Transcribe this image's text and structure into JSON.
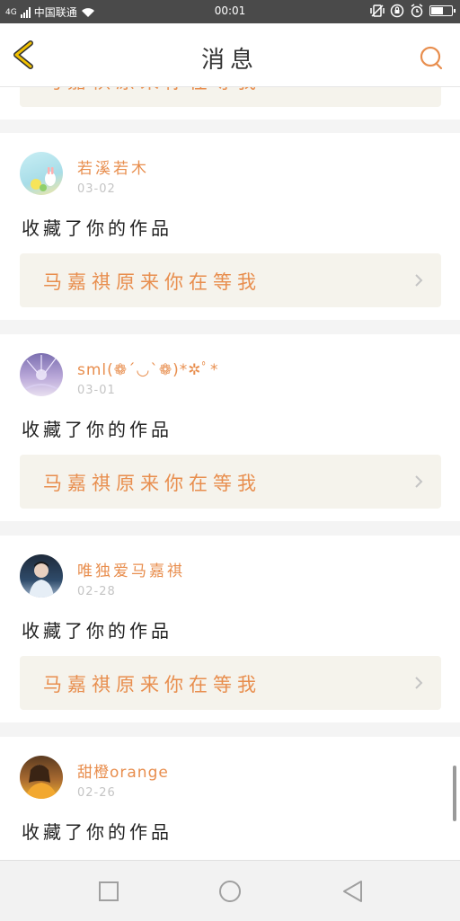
{
  "status_bar": {
    "network": "4G",
    "carrier": "中国联通",
    "time": "00:01",
    "battery_level": 0.6
  },
  "header": {
    "title": "消息",
    "back_icon": "chevron-left-icon",
    "search_icon": "search-icon"
  },
  "colors": {
    "accent": "#e88e4e",
    "back_arrow": "#f0c000",
    "card_bg": "#ffffff",
    "work_bg": "#f5f3ec"
  },
  "partial_card": {
    "work_title": "马嘉祺原来你在等我"
  },
  "notifications": [
    {
      "username": "若溪若木",
      "date": "03-02",
      "action": "收藏了你的作品",
      "work_title": "马嘉祺原来你在等我"
    },
    {
      "username": "sml(❁´◡`❁)*✲ﾟ*",
      "date": "03-01",
      "action": "收藏了你的作品",
      "work_title": "马嘉祺原来你在等我"
    },
    {
      "username": "唯独爱马嘉祺",
      "date": "02-28",
      "action": "收藏了你的作品",
      "work_title": "马嘉祺原来你在等我"
    },
    {
      "username": "甜橙orange",
      "date": "02-26",
      "action": "收藏了你的作品",
      "work_title": ""
    }
  ],
  "nav_bar": {
    "recent_icon": "square-icon",
    "home_icon": "circle-icon",
    "back_icon": "triangle-back-icon"
  }
}
